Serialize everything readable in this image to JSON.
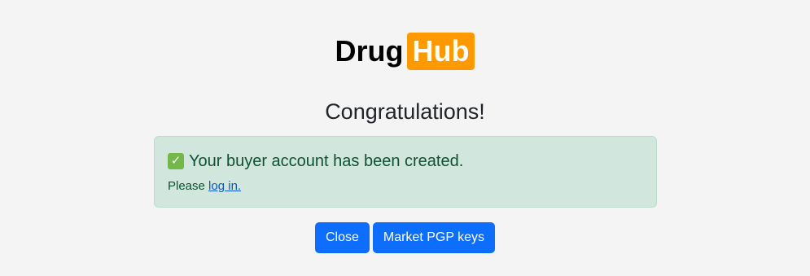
{
  "logo": {
    "first": "Drug",
    "second": "Hub"
  },
  "heading": "Congratulations!",
  "alert": {
    "icon": "check-mark-icon",
    "message": "Your buyer account has been created.",
    "sub_prefix": "Please ",
    "link_text": "log in."
  },
  "buttons": {
    "close": "Close",
    "pgp": "Market PGP keys"
  },
  "colors": {
    "brand_orange": "#ff9900",
    "primary": "#0d6efd",
    "success_bg": "#d1e7dd",
    "success_text": "#0f5132"
  }
}
